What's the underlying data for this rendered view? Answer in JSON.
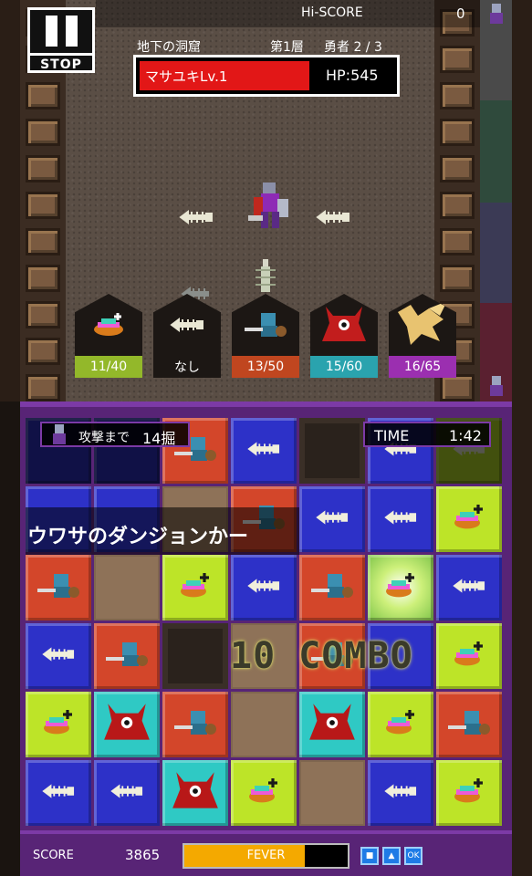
{
  "hud": {
    "stop_label": "STOP",
    "hiscore_label": "Hi-SCORE",
    "hiscore_value": "0",
    "location": "地下の洞窟",
    "floor": "第1層",
    "hero_count": "勇者 2 / 3",
    "hero_name": "マサユキLv.1",
    "hero_hp": "HP:545"
  },
  "cards": [
    {
      "count": "11/40",
      "color": "#93b82a",
      "icon": "food-icon"
    },
    {
      "count": "なし",
      "color": "#1c1714",
      "icon": "fish-bone-icon"
    },
    {
      "count": "13/50",
      "color": "#c0461f",
      "icon": "lizardman-icon"
    },
    {
      "count": "15/60",
      "color": "#2aa3ae",
      "icon": "red-demon-icon"
    },
    {
      "count": "16/65",
      "color": "#9b2fb0",
      "icon": "golden-dragon-icon"
    }
  ],
  "puzzle": {
    "attack_label": "攻撃まで",
    "attack_value": "14掘",
    "time_label": "TIME",
    "time_value": "1:42",
    "scroll_text": "ウワサのダンジョンかー",
    "combo_text": "10 COMBO"
  },
  "bottom": {
    "score_label": "SCORE",
    "score_value": "3865",
    "fever_label": "FEVER",
    "fever_level": 0.74,
    "buttons": [
      "■",
      "▲",
      "OK"
    ]
  },
  "grid": [
    [
      "blue-dim",
      "blue-dim",
      "red",
      "blue",
      "pit",
      "blue",
      "yellow-dim"
    ],
    [
      "blue",
      "blue",
      "dirt",
      "red",
      "blue",
      "blue",
      "yellow"
    ],
    [
      "red",
      "dirt",
      "yellow",
      "blue",
      "red",
      "glow",
      "blue"
    ],
    [
      "blue",
      "red",
      "pit",
      "dirt",
      "red",
      "blue",
      "yellow"
    ],
    [
      "yellow",
      "teal",
      "red",
      "dirt",
      "teal",
      "yellow",
      "red"
    ],
    [
      "blue",
      "blue",
      "teal",
      "yellow",
      "dirt",
      "blue",
      "yellow"
    ]
  ],
  "grid_icons": [
    [
      "",
      "",
      "lizardman-icon",
      "fish-bone-icon",
      "",
      "fish-bone-icon",
      "fish-bone-icon"
    ],
    [
      "",
      "",
      "",
      "lizardman-icon",
      "fish-bone-icon",
      "fish-bone-icon",
      "food-icon"
    ],
    [
      "lizardman-icon",
      "",
      "food-icon",
      "fish-bone-icon",
      "lizardman-icon",
      "food-icon",
      "fish-bone-icon"
    ],
    [
      "fish-bone-icon",
      "lizardman-icon",
      "",
      "",
      "lizardman-icon",
      "",
      "food-icon"
    ],
    [
      "food-icon",
      "red-demon-icon",
      "lizardman-icon",
      "",
      "red-demon-icon",
      "food-icon",
      "lizardman-icon"
    ],
    [
      "fish-bone-icon",
      "fish-bone-icon",
      "red-demon-icon",
      "food-icon",
      "",
      "fish-bone-icon",
      "food-icon"
    ]
  ],
  "colors": {
    "tile_blue": "#2d31c8",
    "tile_red": "#d3462a",
    "tile_yellow": "#bde428",
    "tile_teal": "#2fc9c4",
    "frame_purple": "#582476",
    "hp_red": "#e21717",
    "fever_orange": "#f4a900"
  }
}
